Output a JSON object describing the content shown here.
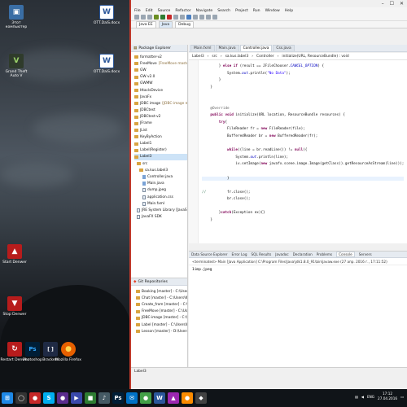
{
  "desktop": {
    "icons": [
      {
        "label": "Этот компьютер",
        "color": "#3a6ea5",
        "glyph": "▣"
      },
      {
        "label": "OTT.DaiS.docx",
        "color": "#2b579a",
        "glyph": "W"
      },
      {
        "label": "Grand Theft Auto V",
        "color": "#2f3b2b",
        "glyph": "V"
      },
      {
        "label": "OTT.DaiS.docx",
        "color": "#2b579a",
        "glyph": "W"
      },
      {
        "label": "Start Denwer",
        "color": "#b71c1c",
        "glyph": "▲"
      },
      {
        "label": "Stop Denwer",
        "color": "#b71c1c",
        "glyph": "▼"
      },
      {
        "label": "Restart Denwer",
        "color": "#b71c1c",
        "glyph": "↻"
      },
      {
        "label": "Photoshop",
        "color": "#001e36",
        "glyph": "Ps"
      },
      {
        "label": "Brackets",
        "color": "#1f2a44",
        "glyph": "[ ]"
      },
      {
        "label": "Mozilla Firefox",
        "color": "#e66000",
        "glyph": "●"
      }
    ]
  },
  "window": {
    "menu": [
      "File",
      "Edit",
      "Source",
      "Refactor",
      "Navigate",
      "Search",
      "Project",
      "Run",
      "Window",
      "Help"
    ],
    "perspectives": [
      "Java EE",
      "Java",
      "Debug"
    ]
  },
  "package_explorer": {
    "title": "Package Explorer",
    "items": [
      {
        "label": "formatter-v2",
        "type": "proj"
      },
      {
        "label": "FreeMove",
        "suffix": "[FreeMove master]",
        "type": "proj"
      },
      {
        "label": "GW",
        "type": "proj"
      },
      {
        "label": "GW v2.0",
        "type": "proj"
      },
      {
        "label": "GWMW",
        "type": "proj"
      },
      {
        "label": "HtaclsDevice",
        "type": "proj"
      },
      {
        "label": "JavaFx",
        "type": "proj"
      },
      {
        "label": "JDBC image",
        "suffix": "[JDBC-image ma]",
        "type": "proj"
      },
      {
        "label": "JDBCtest",
        "type": "proj"
      },
      {
        "label": "JDBCtest-v2",
        "type": "proj"
      },
      {
        "label": "JFrame",
        "type": "proj"
      },
      {
        "label": "JList",
        "type": "proj"
      },
      {
        "label": "KeyByAction",
        "type": "proj"
      },
      {
        "label": "Label1",
        "type": "proj"
      },
      {
        "label": "Label(Register)",
        "type": "proj"
      },
      {
        "label": "Label3",
        "type": "proj"
      },
      {
        "label": "src",
        "type": "folder"
      },
      {
        "label": "sa.kus.label3",
        "type": "folder"
      },
      {
        "label": "Controller.java",
        "type": "java"
      },
      {
        "label": "Main.java",
        "type": "java"
      },
      {
        "label": "dump.jpeg",
        "type": "file"
      },
      {
        "label": "application.css",
        "type": "file"
      },
      {
        "label": "Main.fxml",
        "type": "file"
      },
      {
        "label": "JRE System Library [JavaSE-",
        "type": "file"
      },
      {
        "label": "JavaFX SDK",
        "type": "file"
      }
    ]
  },
  "git": {
    "title": "Git Repositories",
    "items": [
      "Booking [master] - C:\\Users\\KU",
      "Chat [master] - C:\\Users\\KU",
      "Create_from [master] - C:\\Users",
      "FreeMove [master] - C:\\Users",
      "JDBC-image [master] - C:\\Users",
      "Label [master] - C:\\Users\\KU",
      "Lesson [master] - D:\\Users\\KU"
    ]
  },
  "editor": {
    "tabs": [
      "Main.fxml",
      "Main.java",
      "Controller.java",
      "Css.java"
    ],
    "active_tab": "Controller.java",
    "breadcrumb": [
      "Label3",
      "src",
      "sa.kus.label3",
      "Controller",
      "initialize(URL, ResourceBundle) : void"
    ]
  },
  "console": {
    "tabs": [
      "Data Source Explorer",
      "Error Log",
      "SQL Results",
      "Javadoc",
      "Declaration",
      "Problems",
      "Console",
      "Servers"
    ],
    "active_tab": "Console",
    "terminated": "<terminated> Main [Java Application] C:\\Program Files\\Java\\jdk1.8.0_91\\bin\\javaw.exe (27 апр. 2016 г., 17:11:52)",
    "output": "1imp.jpeg"
  },
  "status": {
    "text": "Label3"
  },
  "taskbar": {
    "apps": [
      {
        "glyph": "⊞",
        "color": "#1e88e5"
      },
      {
        "glyph": "◯",
        "color": "#333"
      },
      {
        "glyph": "●",
        "color": "#c62828"
      },
      {
        "glyph": "S",
        "color": "#00aff0"
      },
      {
        "glyph": "●",
        "color": "#5b2d8e"
      },
      {
        "glyph": "▶",
        "color": "#3949ab"
      },
      {
        "glyph": "■",
        "color": "#2e7d32"
      },
      {
        "glyph": "♪",
        "color": "#455a64"
      },
      {
        "glyph": "Ps",
        "color": "#001e36"
      },
      {
        "glyph": "✉",
        "color": "#0072c6"
      },
      {
        "glyph": "●",
        "color": "#43a047"
      },
      {
        "glyph": "W",
        "color": "#2b579a"
      },
      {
        "glyph": "▲",
        "color": "#9c27b0"
      },
      {
        "glyph": "●",
        "color": "#fb8c00"
      },
      {
        "glyph": "◆",
        "color": "#424242"
      }
    ],
    "lang": "ENG",
    "time": "17:12",
    "date": "27.04.2016"
  }
}
